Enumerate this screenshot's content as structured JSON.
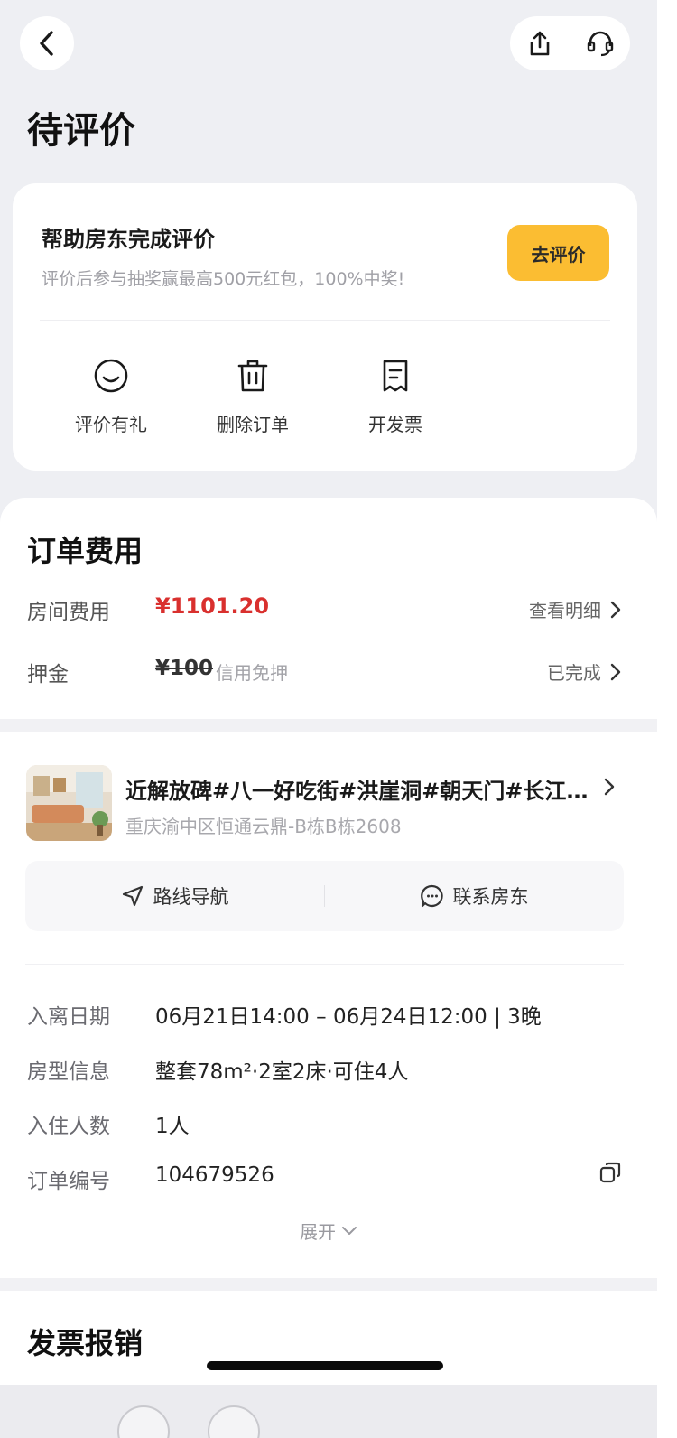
{
  "header": {
    "title": "待评价",
    "back_icon": "chevron-left-icon",
    "share_icon": "share-icon",
    "service_icon": "headset-icon"
  },
  "review_card": {
    "title": "帮助房东完成评价",
    "subtitle": "评价后参与抽奖赢最高500元红包，100%中奖!",
    "button": "去评价",
    "accent": "#fbbd32",
    "actions": [
      {
        "label": "评价有礼",
        "icon": "smile-icon"
      },
      {
        "label": "删除订单",
        "icon": "trash-icon"
      },
      {
        "label": "开发票",
        "icon": "receipt-icon"
      }
    ]
  },
  "fees": {
    "title": "订单费用",
    "room_label": "房间费用",
    "room_price": "¥1101.20",
    "room_link": "查看明细",
    "deposit_label": "押金",
    "deposit_amount": "¥100",
    "deposit_note": "信用免押",
    "deposit_status": "已完成",
    "price_color": "#d9302e"
  },
  "listing": {
    "name": "近解放碑#八一好吃街#洪崖洞#朝天门#长江索道",
    "address": "重庆渝中区恒通云鼎-B栋B栋2608",
    "navigate": "路线导航",
    "contact": "联系房东"
  },
  "order_info": {
    "rows": [
      {
        "label": "入离日期",
        "value": "06月21日14:00 – 06月24日12:00 | 3晚"
      },
      {
        "label": "房型信息",
        "value": "整套78m²·2室2床·可住4人"
      },
      {
        "label": "入住人数",
        "value": "1人"
      },
      {
        "label": "订单编号",
        "value": "104679526"
      }
    ],
    "expand": "展开"
  },
  "invoice": {
    "title": "发票报销"
  }
}
